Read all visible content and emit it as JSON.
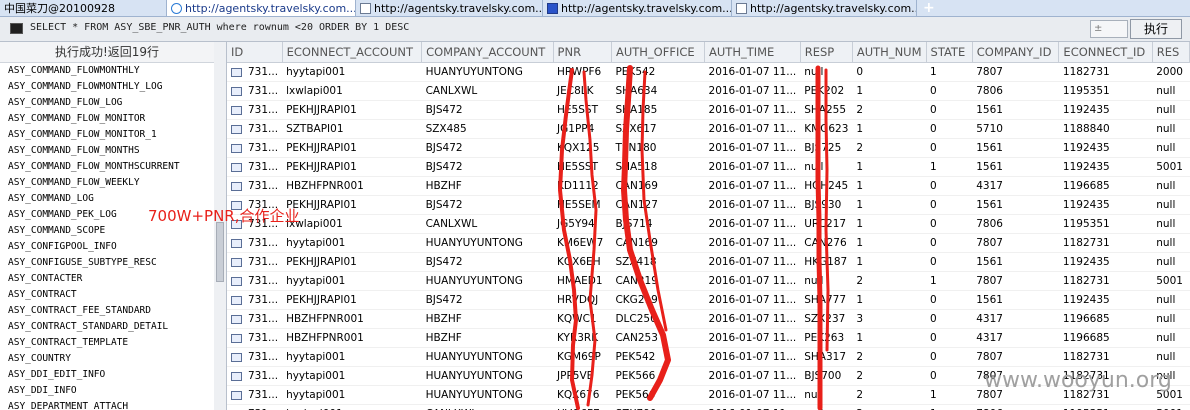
{
  "tabs": [
    {
      "label": "中国菜刀@20100928",
      "icon": "page-icon"
    },
    {
      "label": "http://agentsky.travelsky.com...",
      "icon": "ie-icon"
    },
    {
      "label": "http://agentsky.travelsky.com...",
      "icon": "page-icon"
    },
    {
      "label": "http://agentsky.travelsky.com...",
      "icon": "flag-icon"
    },
    {
      "label": "http://agentsky.travelsky.com...",
      "icon": "page-icon"
    }
  ],
  "new_tab": "+",
  "sql": {
    "query": "SELECT * FROM ASY_SBE_PNR_AUTH where rownum <20 ORDER BY 1 DESC",
    "field_value": "±",
    "run_label": "执行"
  },
  "status_text": "执行成功!返回19行",
  "left_items": [
    "ASY_COMMAND_FLOWMONTHLY",
    "ASY_COMMAND_FLOWMONTHLY_LOG",
    "ASY_COMMAND_FLOW_LOG",
    "ASY_COMMAND_FLOW_MONITOR",
    "ASY_COMMAND_FLOW_MONITOR_1",
    "ASY_COMMAND_FLOW_MONTHS",
    "ASY_COMMAND_FLOW_MONTHSCURRENT",
    "ASY_COMMAND_FLOW_WEEKLY",
    "ASY_COMMAND_LOG",
    "ASY_COMMAND_PEK_LOG",
    "ASY_COMMAND_SCOPE",
    "ASY_CONFIGPOOL_INFO",
    "ASY_CONFIGUSE_SUBTYPE_RESC",
    "ASY_CONTACTER",
    "ASY_CONTRACT",
    "ASY_CONTRACT_FEE_STANDARD",
    "ASY_CONTRACT_STANDARD_DETAIL",
    "ASY_CONTRACT_TEMPLATE",
    "ASY_COUNTRY",
    "ASY_DDI_EDIT_INFO",
    "ASY_DDI_INFO",
    "ASY_DEPARTMENT_ATTACH"
  ],
  "columns": [
    "ID",
    "ECONNECT_ACCOUNT",
    "COMPANY_ACCOUNT",
    "PNR",
    "AUTH_OFFICE",
    "AUTH_TIME",
    "RESP",
    "AUTH_NUM",
    "STATE",
    "COMPANY_ID",
    "ECONNECT_ID",
    "RES"
  ],
  "rows": [
    [
      "731...",
      "hyytapi001",
      "HUANYUYUNTONG",
      "HRWPF6",
      "PEK542",
      "2016-01-07 11...",
      "null",
      "0",
      "1",
      "7807",
      "1182731",
      "2000"
    ],
    [
      "731...",
      "lxwlapi001",
      "CANLXWL",
      "JEC8LK",
      "SHA634",
      "2016-01-07 11...",
      "PEK202",
      "1",
      "0",
      "7806",
      "1195351",
      "null"
    ],
    [
      "731...",
      "PEKHJJRAPI01",
      "BJS472",
      "HE5SST",
      "SHA185",
      "2016-01-07 11...",
      "SHA255",
      "2",
      "0",
      "1561",
      "1192435",
      "null"
    ],
    [
      "731...",
      "SZTBAPI01",
      "SZX485",
      "JG1PP4",
      "SZX617",
      "2016-01-07 11...",
      "KMG623",
      "1",
      "0",
      "5710",
      "1188840",
      "null"
    ],
    [
      "731...",
      "PEKHJJRAPI01",
      "BJS472",
      "KQX125",
      "TSN180",
      "2016-01-07 11...",
      "BJS725",
      "2",
      "0",
      "1561",
      "1192435",
      "null"
    ],
    [
      "731...",
      "PEKHJJRAPI01",
      "BJS472",
      "HE5SST",
      "SHA518",
      "2016-01-07 11...",
      "null",
      "1",
      "1",
      "1561",
      "1192435",
      "5001"
    ],
    [
      "731...",
      "HBZHFPNR001",
      "HBZHF",
      "KD1112",
      "CAN169",
      "2016-01-07 11...",
      "HGH245",
      "1",
      "0",
      "4317",
      "1196685",
      "null"
    ],
    [
      "731...",
      "PEKHJJRAPI01",
      "BJS472",
      "HE5SEM",
      "CAN127",
      "2016-01-07 11...",
      "BJS930",
      "1",
      "0",
      "1561",
      "1192435",
      "null"
    ],
    [
      "731...",
      "lxwlapi001",
      "CANLXWL",
      "JG5Y94",
      "BJS714",
      "2016-01-07 11...",
      "URC217",
      "1",
      "0",
      "7806",
      "1195351",
      "null"
    ],
    [
      "731...",
      "hyytapi001",
      "HUANYUYUNTONG",
      "KM6EW7",
      "CAN169",
      "2016-01-07 11...",
      "CAN276",
      "1",
      "0",
      "7807",
      "1182731",
      "null"
    ],
    [
      "731...",
      "PEKHJJRAPI01",
      "BJS472",
      "KQX6EH",
      "SZX418",
      "2016-01-07 11...",
      "HKG187",
      "1",
      "0",
      "1561",
      "1192435",
      "null"
    ],
    [
      "731...",
      "hyytapi001",
      "HUANYUYUNTONG",
      "HMAED1",
      "CAN219",
      "2016-01-07 11...",
      "null",
      "2",
      "1",
      "7807",
      "1182731",
      "5001"
    ],
    [
      "731...",
      "PEKHJJRAPI01",
      "BJS472",
      "HRVDQJ",
      "CKG219",
      "2016-01-07 11...",
      "SHA777",
      "1",
      "0",
      "1561",
      "1192435",
      "null"
    ],
    [
      "731...",
      "HBZHFPNR001",
      "HBZHF",
      "KQWC1",
      "DLC250",
      "2016-01-07 11...",
      "SZX237",
      "3",
      "0",
      "4317",
      "1196685",
      "null"
    ],
    [
      "731...",
      "HBZHFPNR001",
      "HBZHF",
      "KYR3RK",
      "CAN253",
      "2016-01-07 11...",
      "PEK263",
      "1",
      "0",
      "4317",
      "1196685",
      "null"
    ],
    [
      "731...",
      "hyytapi001",
      "HUANYUYUNTONG",
      "KGM69P",
      "PEK542",
      "2016-01-07 11...",
      "SHA317",
      "2",
      "0",
      "7807",
      "1182731",
      "null"
    ],
    [
      "731...",
      "hyytapi001",
      "HUANYUYUNTONG",
      "JPP5VE",
      "PEK566",
      "2016-01-07 11...",
      "BJS700",
      "2",
      "0",
      "7807",
      "1182731",
      "null"
    ],
    [
      "731...",
      "hyytapi001",
      "HUANYUYUNTONG",
      "KQX676",
      "PEK566",
      "2016-01-07 11...",
      "null",
      "2",
      "1",
      "7807",
      "1182731",
      "5001"
    ],
    [
      "731...",
      "lxwlapi001",
      "CANLXWL",
      "HVQ6F7",
      "SZX790",
      "2016-01-07 11...",
      "null",
      "2",
      "1",
      "7806",
      "1195351",
      "5001"
    ]
  ],
  "annotation": "700W+PNR,合作企业",
  "watermark": "www.wooyun.org",
  "colors": {
    "annotation": "#e8201a",
    "redaction_marks": "#e8201a",
    "tab_active_text": "#1a3a8a",
    "watermark": "#a0a0a0"
  }
}
